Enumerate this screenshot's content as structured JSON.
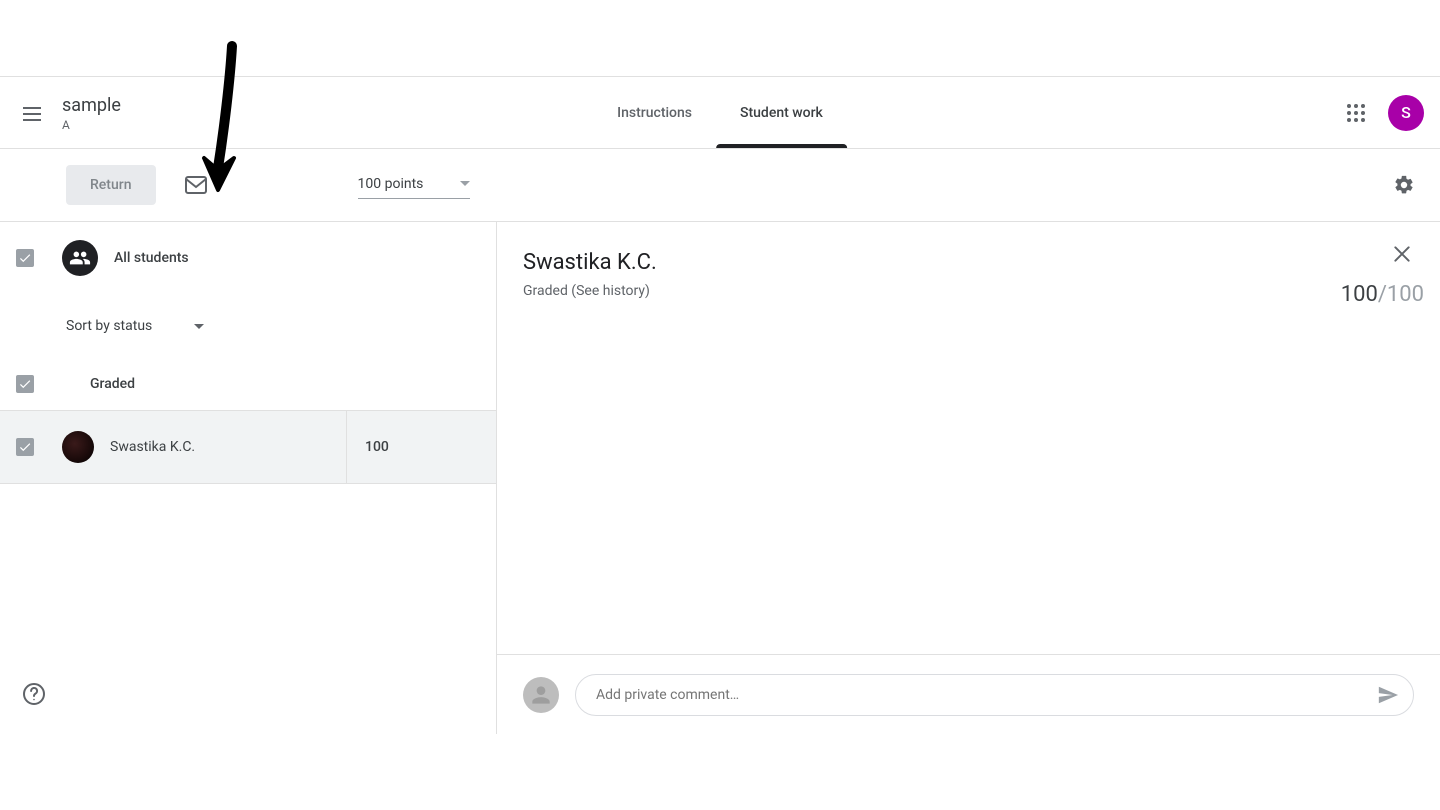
{
  "header": {
    "title": "sample",
    "subtitle": "A",
    "avatar_letter": "S"
  },
  "tabs": {
    "instructions": "Instructions",
    "student_work": "Student work"
  },
  "toolbar": {
    "return_label": "Return",
    "points_label": "100 points"
  },
  "sidebar": {
    "all_students_label": "All students",
    "sort_label": "Sort by status",
    "group_label": "Graded",
    "students": [
      {
        "name": "Swastika K.C.",
        "score": "100"
      }
    ]
  },
  "detail": {
    "student_name": "Swastika K.C.",
    "status": "Graded (See history)",
    "score": "100",
    "out_of_sep": "/",
    "out_of": "100",
    "comment_placeholder": "Add private comment…"
  }
}
